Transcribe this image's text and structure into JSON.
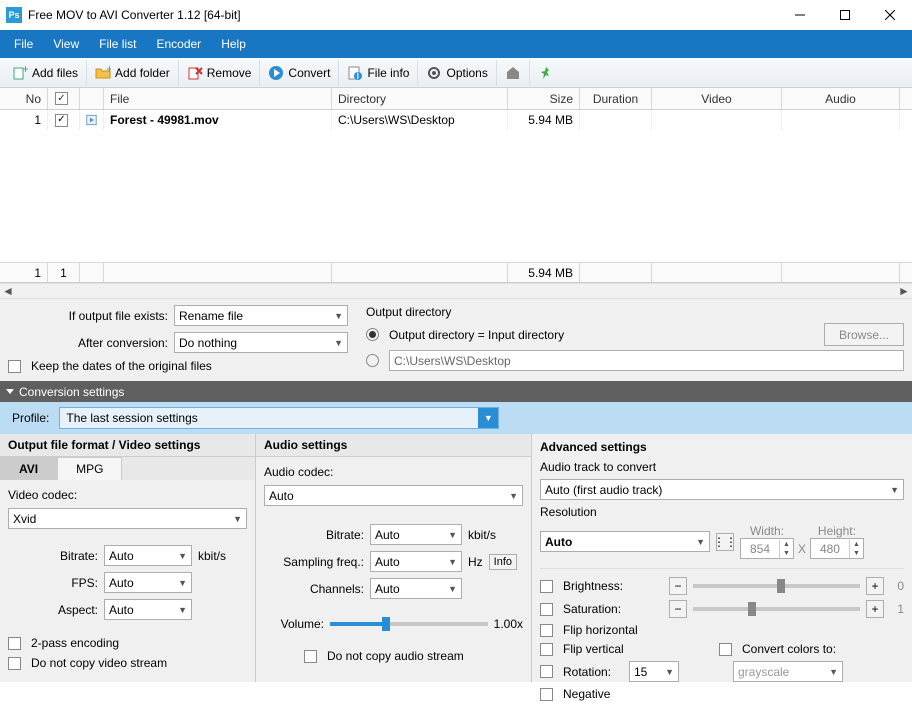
{
  "title": "Free MOV to AVI Converter 1.12  [64-bit]",
  "menu": [
    "File",
    "View",
    "File list",
    "Encoder",
    "Help"
  ],
  "toolbar": {
    "addfiles": "Add files",
    "addfolder": "Add folder",
    "remove": "Remove",
    "convert": "Convert",
    "fileinfo": "File info",
    "options": "Options"
  },
  "table": {
    "headers": {
      "no": "No",
      "file": "File",
      "dir": "Directory",
      "size": "Size",
      "dur": "Duration",
      "video": "Video",
      "audio": "Audio"
    },
    "rows": [
      {
        "no": "1",
        "file": "Forest - 49981.mov",
        "dir": "C:\\Users\\WS\\Desktop",
        "size": "5.94 MB",
        "dur": "",
        "video": "",
        "audio": ""
      }
    ],
    "footer": {
      "count": "1",
      "sel": "1",
      "size": "5.94 MB"
    }
  },
  "mid": {
    "exists_label": "If output file exists:",
    "exists_value": "Rename file",
    "after_label": "After conversion:",
    "after_value": "Do nothing",
    "keepdates": "Keep the dates of the original files",
    "outdir_label": "Output directory",
    "outdir_same": "Output directory = Input directory",
    "outdir_custom": "C:\\Users\\WS\\Desktop",
    "browse": "Browse..."
  },
  "conv_header": "Conversion settings",
  "profile_label": "Profile:",
  "profile_value": "The last session settings",
  "video": {
    "header": "Output file format / Video settings",
    "tab_avi": "AVI",
    "tab_mpg": "MPG",
    "codec_label": "Video codec:",
    "codec_value": "Xvid",
    "bitrate_label": "Bitrate:",
    "bitrate_value": "Auto",
    "bitrate_unit": "kbit/s",
    "fps_label": "FPS:",
    "fps_value": "Auto",
    "aspect_label": "Aspect:",
    "aspect_value": "Auto",
    "twopass": "2-pass encoding",
    "nocopyv": "Do not copy video stream"
  },
  "audio": {
    "header": "Audio settings",
    "codec_label": "Audio codec:",
    "codec_value": "Auto",
    "bitrate_label": "Bitrate:",
    "bitrate_value": "Auto",
    "bitrate_unit": "kbit/s",
    "sfreq_label": "Sampling freq.:",
    "sfreq_value": "Auto",
    "sfreq_unit": "Hz",
    "channels_label": "Channels:",
    "channels_value": "Auto",
    "volume_label": "Volume:",
    "volume_value": "1.00x",
    "info": "Info",
    "nocopya": "Do not copy audio stream"
  },
  "adv": {
    "header": "Advanced settings",
    "track_label": "Audio track to convert",
    "track_value": "Auto (first audio track)",
    "res_label": "Resolution",
    "res_value": "Auto",
    "width_label": "Width:",
    "width_value": "854",
    "x": "X",
    "height_label": "Height:",
    "height_value": "480",
    "brightness": "Brightness:",
    "brightness_val": "0",
    "saturation": "Saturation:",
    "saturation_val": "1",
    "fliph": "Flip horizontal",
    "flipv": "Flip vertical",
    "rotation": "Rotation:",
    "rotation_value": "15",
    "convcolors": "Convert colors to:",
    "grayscale": "grayscale",
    "negative": "Negative"
  }
}
